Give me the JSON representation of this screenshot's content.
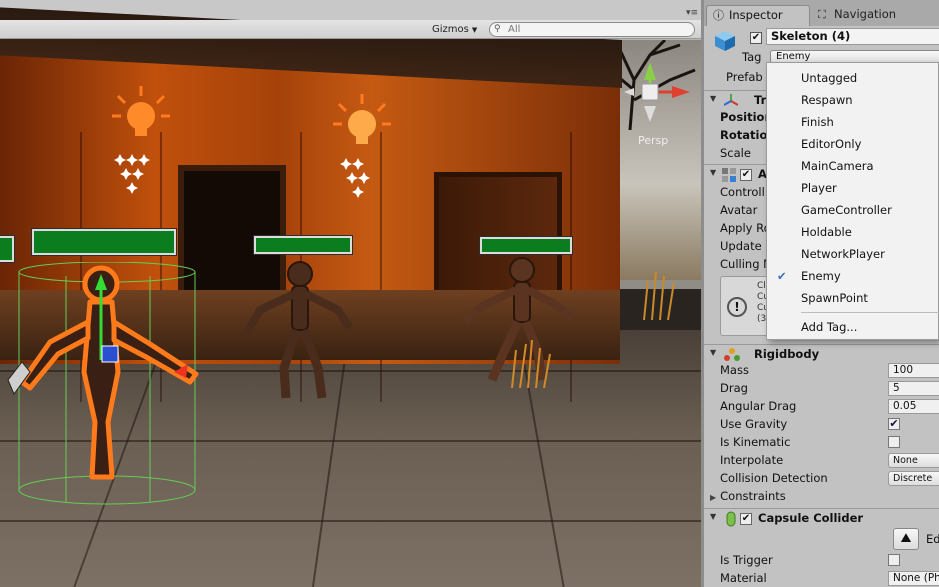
{
  "scene": {
    "gizmos_label": "Gizmos",
    "search_placeholder": "All",
    "persp_label": "Persp"
  },
  "inspector": {
    "tabs": [
      {
        "label": "Inspector",
        "icon": "info-icon"
      },
      {
        "label": "Navigation",
        "icon": "navigation-icon"
      }
    ],
    "object": {
      "name": "Skeleton (4)",
      "active": true,
      "tag_label": "Tag",
      "tag_value": "Enemy",
      "prefab_label": "Prefab"
    },
    "transform": {
      "title": "Tr",
      "position_label": "Position",
      "rotation_label": "Rotation",
      "scale_label": "Scale"
    },
    "animator": {
      "title": "An",
      "controller_label": "Controll",
      "avatar_label": "Avatar",
      "apply_root_label": "Apply Ro",
      "update_label": "Update M",
      "culling_label": "Culling M",
      "help_lines": [
        "Cl",
        "Cu",
        "Cu",
        "(3"
      ]
    },
    "rigidbody": {
      "title": "Rigidbody",
      "fields": [
        {
          "label": "Mass",
          "value": "100"
        },
        {
          "label": "Drag",
          "value": "5"
        },
        {
          "label": "Angular Drag",
          "value": "0.05"
        }
      ],
      "use_gravity_label": "Use Gravity",
      "use_gravity": true,
      "is_kinematic_label": "Is Kinematic",
      "is_kinematic": false,
      "interpolate_label": "Interpolate",
      "interpolate_value": "None",
      "collision_label": "Collision Detection",
      "collision_value": "Discrete",
      "constraints_label": "Constraints"
    },
    "capsule_collider": {
      "title": "Capsule Collider",
      "edit_label": "Ed",
      "is_trigger_label": "Is Trigger",
      "is_trigger": false,
      "material_label": "Material",
      "material_value": "None (Ph"
    }
  },
  "tag_dropdown": {
    "items": [
      "Untagged",
      "Respawn",
      "Finish",
      "EditorOnly",
      "MainCamera",
      "Player",
      "GameController",
      "Holdable",
      "NetworkPlayer",
      "Enemy",
      "SpawnPoint"
    ],
    "selected": "Enemy",
    "add_label": "Add Tag...",
    "check_color": "#3d6ec4"
  }
}
